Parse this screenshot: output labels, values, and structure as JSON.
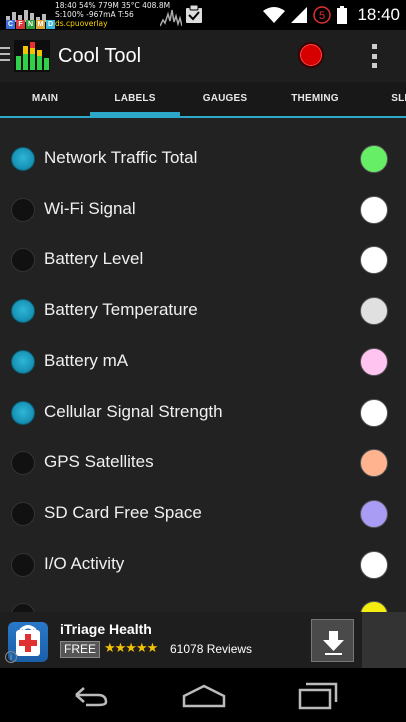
{
  "status_bar": {
    "cpu_line1": "18:40 54% 779M 35°C 408.8M",
    "cpu_line2": "S:100% -967mA T:56",
    "cpu_line3": "ds.cpuoverlay",
    "letters": [
      "C",
      "F",
      "N",
      "M",
      "D"
    ],
    "letter_colors": [
      "#3a6fd8",
      "#d83a3a",
      "#2e9e3a",
      "#d8a63a",
      "#3ab6d8"
    ],
    "notification_badge": "5",
    "clock": "18:40"
  },
  "action_bar": {
    "title": "Cool Tool",
    "record_color": "#d60000",
    "icons": [
      "menu-icon",
      "equalizer-icon",
      "record-icon",
      "overflow-menu-icon"
    ]
  },
  "tabs": [
    {
      "label": "MAIN",
      "active": false
    },
    {
      "label": "LABELS",
      "active": true
    },
    {
      "label": "GAUGES",
      "active": false
    },
    {
      "label": "THEMING",
      "active": false
    },
    {
      "label": "SLID",
      "active": false
    }
  ],
  "accent_color": "#2ea8c8",
  "list_items": [
    {
      "label": "Network Traffic Total",
      "enabled": true,
      "color": "#66ee66"
    },
    {
      "label": "Wi-Fi Signal",
      "enabled": false,
      "color": "#ffffff"
    },
    {
      "label": "Battery Level",
      "enabled": false,
      "color": "#ffffff"
    },
    {
      "label": "Battery Temperature",
      "enabled": true,
      "color": "#e0e0e0"
    },
    {
      "label": "Battery mA",
      "enabled": true,
      "color": "#ffc4f0"
    },
    {
      "label": "Cellular Signal Strength",
      "enabled": true,
      "color": "#ffffff"
    },
    {
      "label": "GPS Satellites",
      "enabled": false,
      "color": "#ffb38e"
    },
    {
      "label": "SD Card Free Space",
      "enabled": false,
      "color": "#a89cf4"
    },
    {
      "label": "I/O Activity",
      "enabled": false,
      "color": "#ffffff"
    }
  ],
  "ad": {
    "title": "iTriage Health",
    "price": "FREE",
    "stars": "★★★★★",
    "rating": 4.5,
    "reviews": "61078 Reviews",
    "info_glyph": "i"
  },
  "nav_bar": {
    "buttons": [
      "back-icon",
      "home-icon",
      "recents-icon"
    ]
  }
}
